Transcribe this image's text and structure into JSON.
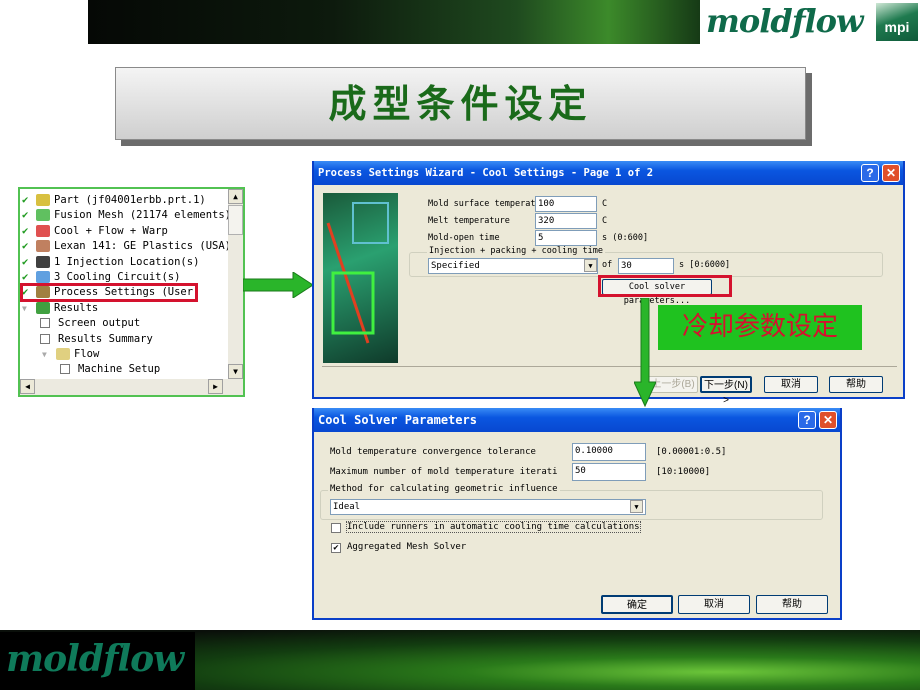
{
  "header": {
    "logo": "moldflow",
    "logo_badge": "mpi"
  },
  "slide_title": "成型条件设定",
  "tree": {
    "items": [
      {
        "label": "Part (jf04001erbb.prt.1)",
        "checked": true,
        "icon": "part-icon"
      },
      {
        "label": "Fusion Mesh (21174 elements)",
        "checked": true,
        "icon": "mesh-icon"
      },
      {
        "label": "Cool + Flow + Warp",
        "checked": true,
        "icon": "analysis-icon"
      },
      {
        "label": "Lexan 141: GE Plastics (USA)",
        "checked": true,
        "icon": "material-icon"
      },
      {
        "label": "1 Injection Location(s)",
        "checked": true,
        "icon": "injection-icon"
      },
      {
        "label": "3 Cooling Circuit(s)",
        "checked": true,
        "icon": "cooling-icon"
      },
      {
        "label": "Process Settings (User)",
        "checked": true,
        "icon": "process-settings-icon",
        "highlighted": true
      },
      {
        "label": "Results",
        "icon": "results-icon"
      },
      {
        "label": "Screen output"
      },
      {
        "label": "Results Summary"
      },
      {
        "label": "Flow",
        "icon": "folder-icon"
      },
      {
        "label": "Machine Setup"
      }
    ]
  },
  "wizard": {
    "title": "Process Settings Wizard - Cool Settings - Page 1 of 2",
    "fields": [
      {
        "label": "Mold surface temperatu",
        "value": "100",
        "unit": "C"
      },
      {
        "label": "Melt temperature",
        "value": "320",
        "unit": "C"
      },
      {
        "label": "Mold-open time",
        "value": "5",
        "unit": "s (0:600]"
      }
    ],
    "group_label": "Injection + packing + cooling time",
    "mode": "Specified",
    "of_label": "of",
    "time_value": "30",
    "time_unit": "s [0:6000]",
    "cool_solver_button": "Cool solver parameters...",
    "back": "上一步(B)",
    "next": "下一步(N) >",
    "cancel": "取消",
    "help": "帮助"
  },
  "annotation": "冷却参数设定",
  "solver": {
    "title": "Cool Solver Parameters",
    "fields": [
      {
        "label": "Mold temperature convergence tolerance",
        "value": "0.10000",
        "range": "[0.00001:0.5]"
      },
      {
        "label": "Maximum number of mold temperature iterati",
        "value": "50",
        "range": "[10:10000]"
      }
    ],
    "group_label": "Method for calculating geometric influence",
    "method": "Ideal",
    "include_runners": {
      "label": "Include runners in automatic cooling time calculations",
      "checked": false
    },
    "aggregated": {
      "label": "Aggregated Mesh Solver",
      "checked": true
    },
    "ok": "确定",
    "cancel": "取消",
    "help": "帮助"
  },
  "footer": {
    "logo": "moldflow"
  },
  "colors": {
    "highlight": "#d4122e",
    "arrow": "#2ab52a",
    "title_bar": "#0a56e0",
    "annotation_bg": "#1fc21f",
    "annotation_text": "#d4122e"
  }
}
